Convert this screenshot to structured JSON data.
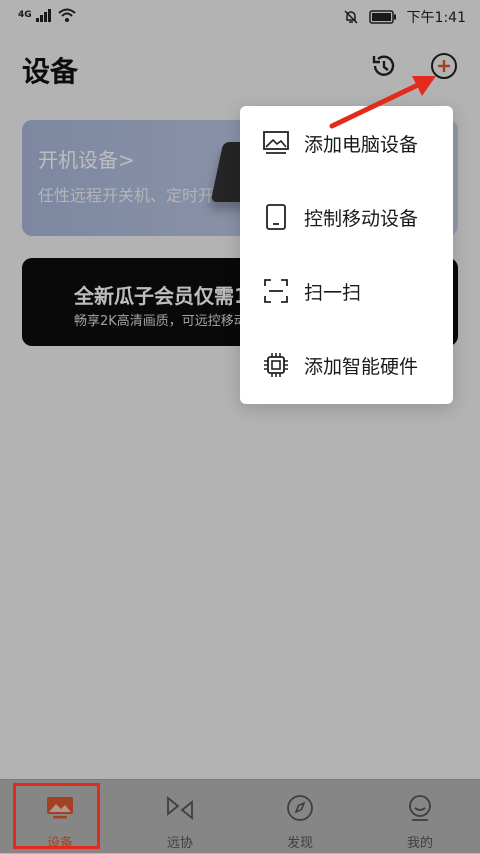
{
  "status_bar": {
    "network": "4G",
    "time": "下午1:41"
  },
  "header": {
    "title": "设备",
    "history_icon": "history-icon",
    "add_icon": "add-circle-icon"
  },
  "cards": {
    "power": {
      "title": "开机设备",
      "chevron": ">",
      "subtitle": "任性远程开关机、定时开"
    },
    "vip": {
      "title": "全新瓜子会员仅需1",
      "subtitle": "畅享2K高清画质，可远控移动"
    }
  },
  "menu": {
    "items": [
      {
        "label": "添加电脑设备",
        "icon": "computer-icon"
      },
      {
        "label": "控制移动设备",
        "icon": "tablet-icon"
      },
      {
        "label": "扫一扫",
        "icon": "scan-icon"
      },
      {
        "label": "添加智能硬件",
        "icon": "chip-icon"
      }
    ]
  },
  "tabs": [
    {
      "label": "设备",
      "icon": "devices-icon",
      "active": true
    },
    {
      "label": "远协",
      "icon": "remote-assist-icon",
      "active": false
    },
    {
      "label": "发现",
      "icon": "compass-icon",
      "active": false
    },
    {
      "label": "我的",
      "icon": "profile-icon",
      "active": false
    }
  ],
  "colors": {
    "accent": "#d95a2f",
    "annotation": "#e22b1a"
  }
}
